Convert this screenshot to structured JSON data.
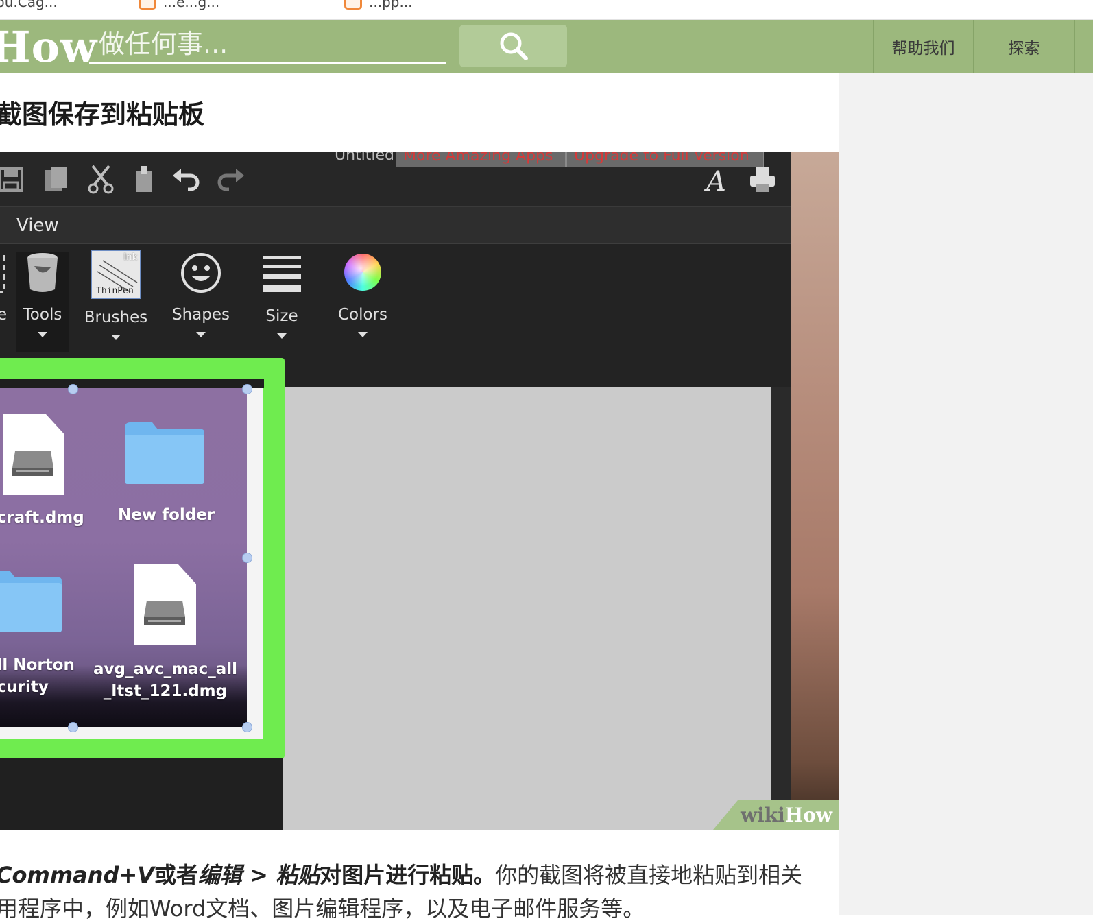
{
  "bookmarks": [
    {
      "label": "pu.Cag..."
    },
    {
      "label": "...e...g..."
    },
    {
      "label": "...pp..."
    }
  ],
  "header": {
    "logo": "How",
    "search_placeholder": "做任何事...",
    "nav": [
      "帮助我们",
      "探索"
    ]
  },
  "article": {
    "step_title": "截图保存到粘贴板",
    "body_line1_parts": [
      "Command+V",
      "或者",
      "编辑 > 粘贴",
      "对图片进行粘贴。",
      "你的截图将被直接地粘贴到相关"
    ],
    "body_line2": "用程序中，例如Word文档、图片编辑程序，以及电子邮件服务等。"
  },
  "screenshot": {
    "tabs": [
      "More Amazing Apps",
      "Upgrade to Full Version"
    ],
    "tab_prefix": "Untitled",
    "menu": "View",
    "ribbon": [
      "e",
      "Tools",
      "Brushes",
      "Shapes",
      "Size",
      "Colors"
    ],
    "brush_thumb": {
      "top": "Ink",
      "bottom": "ThinPen"
    },
    "files": [
      {
        "name": "ecraft.dmg"
      },
      {
        "name": "New folder"
      },
      {
        "name": "all Norton\necurity"
      },
      {
        "name": "avg_avc_mac_all\n_ltst_121.dmg"
      }
    ],
    "watermark": {
      "a": "wiki",
      "b": "How"
    }
  }
}
